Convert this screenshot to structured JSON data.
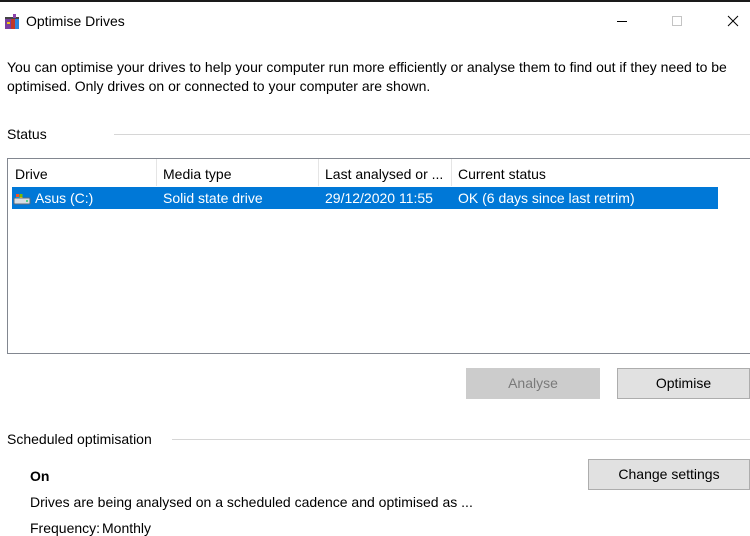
{
  "window": {
    "title": "Optimise Drives",
    "controls": [
      "minimize-icon",
      "maximize-icon",
      "close-icon"
    ]
  },
  "description": "You can optimise your drives to help your computer run more efficiently or analyse them to find out if they need to be optimised. Only drives on or connected to your computer are shown.",
  "status": {
    "label": "Status",
    "columns": [
      "Drive",
      "Media type",
      "Last analysed or ...",
      "Current status"
    ],
    "rows": [
      {
        "drive": "Asus (C:)",
        "media_type": "Solid state drive",
        "last_analysed": "29/12/2020 11:55",
        "current_status": "OK (6 days since last retrim)",
        "selected": true,
        "icon": "drive-icon"
      }
    ]
  },
  "buttons": {
    "analyse": "Analyse",
    "optimise": "Optimise",
    "change_settings": "Change settings"
  },
  "scheduled": {
    "label": "Scheduled optimisation",
    "state": "On",
    "description": "Drives are being analysed on a scheduled cadence and optimised as ...",
    "frequency_label": "Frequency:",
    "frequency_value": "Monthly"
  },
  "colors": {
    "selection": "#0078d7",
    "button_bg": "#e1e1e1",
    "button_disabled_bg": "#cccccc",
    "separator": "#d6d6d6"
  }
}
